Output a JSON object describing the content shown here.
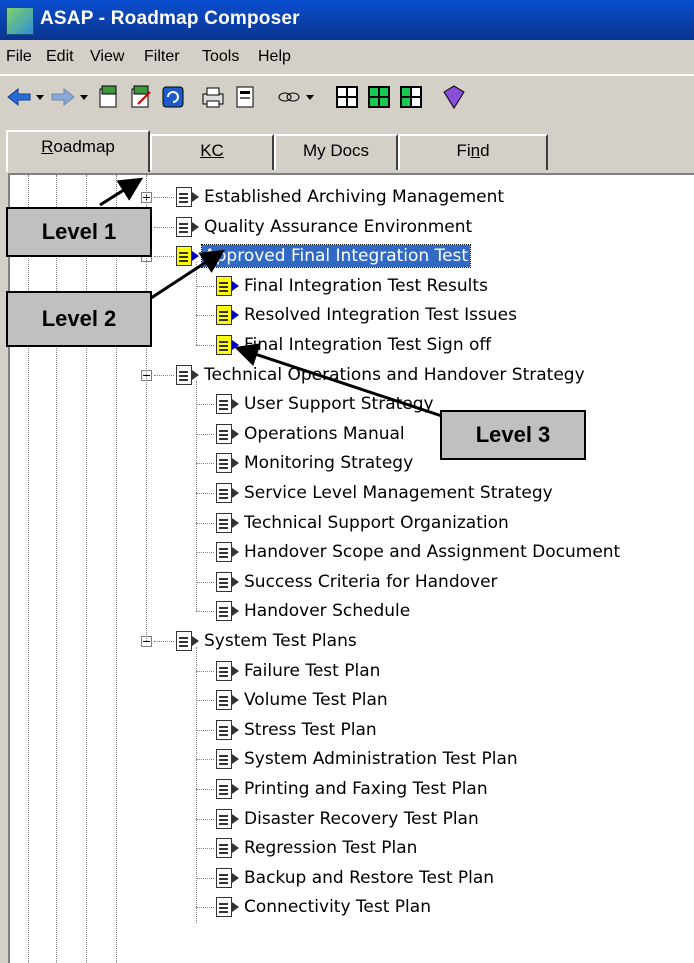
{
  "window": {
    "title": "ASAP - Roadmap Composer"
  },
  "menu": [
    "File",
    "Edit",
    "View",
    "Filter",
    "Tools",
    "Help"
  ],
  "toolbar_icons": [
    "back-arrow-icon",
    "dropdown-icon",
    "forward-arrow-icon",
    "dropdown-icon",
    "doc-add-icon",
    "doc-edit-icon",
    "refresh-icon",
    "print-icon",
    "properties-icon",
    "link-icon",
    "dropdown-icon",
    "layout-1-icon",
    "layout-2-icon",
    "layout-3-icon",
    "book-icon"
  ],
  "tabs": [
    {
      "label": "Roadmap",
      "mnemonic": "R",
      "rest": "oadmap",
      "active": true
    },
    {
      "label": "KC",
      "mnemonic": "KC",
      "rest": "",
      "active": false
    },
    {
      "label": "My Docs",
      "mnemonic": "",
      "rest": "My Docs",
      "active": false
    },
    {
      "label": "Find",
      "mnemonic": "n",
      "pre": "Fi",
      "rest": "d",
      "active": false
    }
  ],
  "tree": [
    {
      "label": "Established Archiving Management",
      "level": 1,
      "expander": "plus"
    },
    {
      "label": "Quality Assurance Environment",
      "level": 1,
      "expander": "plus"
    },
    {
      "label": "Approved Final Integration Test",
      "level": 1,
      "expander": "minus",
      "selected": true,
      "highlight": true
    },
    {
      "label": "Final Integration Test Results",
      "level": 2,
      "highlight": true
    },
    {
      "label": "Resolved Integration Test Issues",
      "level": 2,
      "highlight": true
    },
    {
      "label": "Final Integration Test Sign off",
      "level": 2,
      "highlight": true
    },
    {
      "label": "Technical Operations and Handover Strategy",
      "level": 1,
      "expander": "minus"
    },
    {
      "label": "User Support Strategy",
      "level": 2
    },
    {
      "label": "Operations Manual",
      "level": 2
    },
    {
      "label": "Monitoring Strategy",
      "level": 2
    },
    {
      "label": "Service Level Management Strategy",
      "level": 2
    },
    {
      "label": "Technical Support Organization",
      "level": 2
    },
    {
      "label": "Handover Scope and Assignment Document",
      "level": 2
    },
    {
      "label": "Success Criteria for Handover",
      "level": 2
    },
    {
      "label": "Handover Schedule",
      "level": 2
    },
    {
      "label": "System Test Plans",
      "level": 1,
      "expander": "minus"
    },
    {
      "label": "Failure Test Plan",
      "level": 2
    },
    {
      "label": "Volume Test Plan",
      "level": 2
    },
    {
      "label": "Stress Test Plan",
      "level": 2
    },
    {
      "label": "System Administration Test Plan",
      "level": 2
    },
    {
      "label": "Printing and Faxing Test Plan",
      "level": 2
    },
    {
      "label": "Disaster Recovery Test Plan",
      "level": 2
    },
    {
      "label": "Regression Test Plan",
      "level": 2
    },
    {
      "label": "Backup and Restore Test Plan",
      "level": 2
    },
    {
      "label": "Connectivity Test Plan",
      "level": 2
    }
  ],
  "callouts": {
    "level1": "Level 1",
    "level2": "Level 2",
    "level3": "Level 3"
  },
  "colors": {
    "selection": "#316ac5",
    "highlight_icon": "#ffff00",
    "titlebar": "#0b3fa8"
  }
}
